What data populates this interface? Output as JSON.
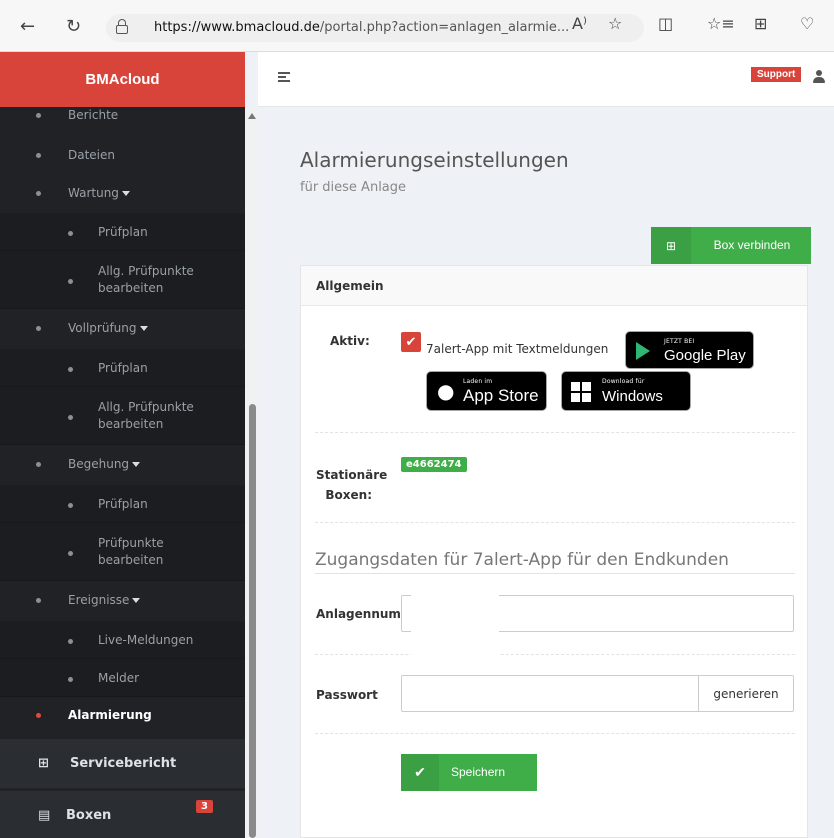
{
  "browser": {
    "url_host": "https://www.bmacloud.de",
    "url_path": "/portal.php?action=anlagen_alarmie...",
    "read_aloud": "A⁾"
  },
  "app": {
    "brand": "BMAcloud",
    "support_label": "Support"
  },
  "sidebar": {
    "items": [
      {
        "label": "Berichte"
      },
      {
        "label": "Dateien"
      },
      {
        "label": "Wartung"
      },
      {
        "label": "Prüfplan"
      },
      {
        "label": "Allg. Prüfpunkte bearbeiten"
      },
      {
        "label": "Vollprüfung"
      },
      {
        "label": "Prüfplan"
      },
      {
        "label": "Allg. Prüfpunkte bearbeiten"
      },
      {
        "label": "Begehung"
      },
      {
        "label": "Prüfplan"
      },
      {
        "label": "Prüfpunkte bearbeiten"
      },
      {
        "label": "Ereignisse"
      },
      {
        "label": "Live-Meldungen"
      },
      {
        "label": "Melder"
      },
      {
        "label": "Alarmierung"
      }
    ],
    "servicebericht": "Servicebericht",
    "boxen": "Boxen",
    "boxen_badge": "3"
  },
  "page": {
    "title": "Alarmierungseinstellungen",
    "subtitle": "für diese Anlage",
    "box_button": "Box verbinden"
  },
  "panel": {
    "heading": "Allgemein",
    "active_label": "Aktiv:",
    "checkbox_label": "7alert-App mit Textmeldungen",
    "stationary_label_1": "Stationäre",
    "stationary_label_2": "Boxen:",
    "box_id": "e4662474",
    "access_title": "Zugangsdaten für 7alert-App für den Endkunden",
    "anlagennummer_label": "Anlagennumm",
    "passwort_label": "Passwort",
    "generate_button": "generieren",
    "save_button": "Speichern"
  },
  "stores": {
    "google_small": "JETZT BEI",
    "google_big": "Google Play",
    "apple_small": "Laden im",
    "apple_big": "App Store",
    "windows_small": "Download für",
    "windows_big": "Windows"
  }
}
